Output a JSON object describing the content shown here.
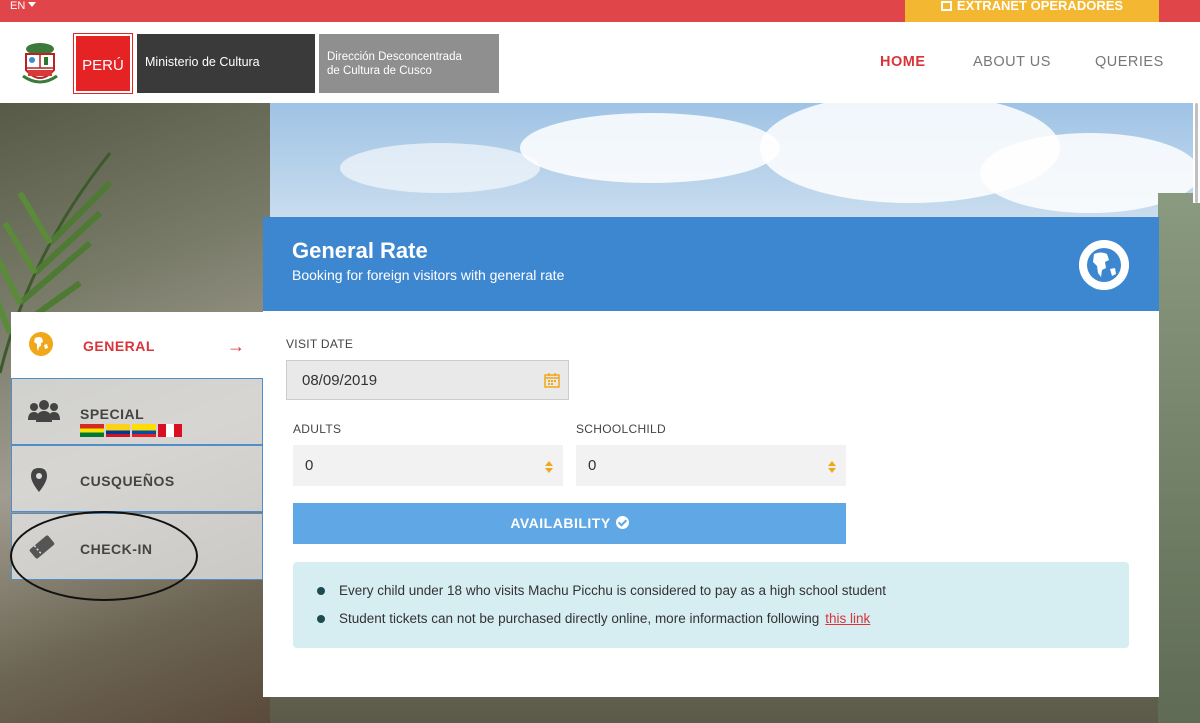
{
  "topbar": {
    "language": "EN",
    "extranet_label": "EXTRANET OPERADORES",
    "colors": {
      "bar": "#e0454a",
      "extranet": "#f4b731"
    }
  },
  "header": {
    "logo_peru": "PERÚ",
    "logo_ministry": "Ministerio de Cultura",
    "logo_direction_line1": "Dirección Desconcentrada",
    "logo_direction_line2": "de Cultura de Cusco",
    "nav": [
      {
        "label": "HOME",
        "active": true
      },
      {
        "label": "ABOUT US",
        "active": false
      },
      {
        "label": "QUERIES",
        "active": false
      }
    ]
  },
  "booking": {
    "title": "General Rate",
    "subtitle": "Booking for foreign visitors with general rate",
    "visit_date_label": "VISIT DATE",
    "visit_date_value": "08/09/2019",
    "adults_label": "ADULTS",
    "adults_value": "0",
    "schoolchild_label": "SCHOOLCHILD",
    "schoolchild_value": "0",
    "availability_button": "AVAILABILITY",
    "notices": [
      "Every child under 18 who visits Machu Picchu is considered to pay as a high school student",
      "Student tickets can not be purchased directly online, more informaction following"
    ],
    "notice_link": "this link",
    "accent_color": "#3d87d1"
  },
  "side_menu": {
    "items": [
      {
        "label": "GENERAL",
        "icon": "globe-icon",
        "active": true
      },
      {
        "label": "SPECIAL",
        "icon": "group-icon",
        "active": false
      },
      {
        "label": "CUSQUEÑOS",
        "icon": "map-pin-icon",
        "active": false
      },
      {
        "label": "CHECK-IN",
        "icon": "ticket-icon",
        "active": false
      }
    ]
  }
}
